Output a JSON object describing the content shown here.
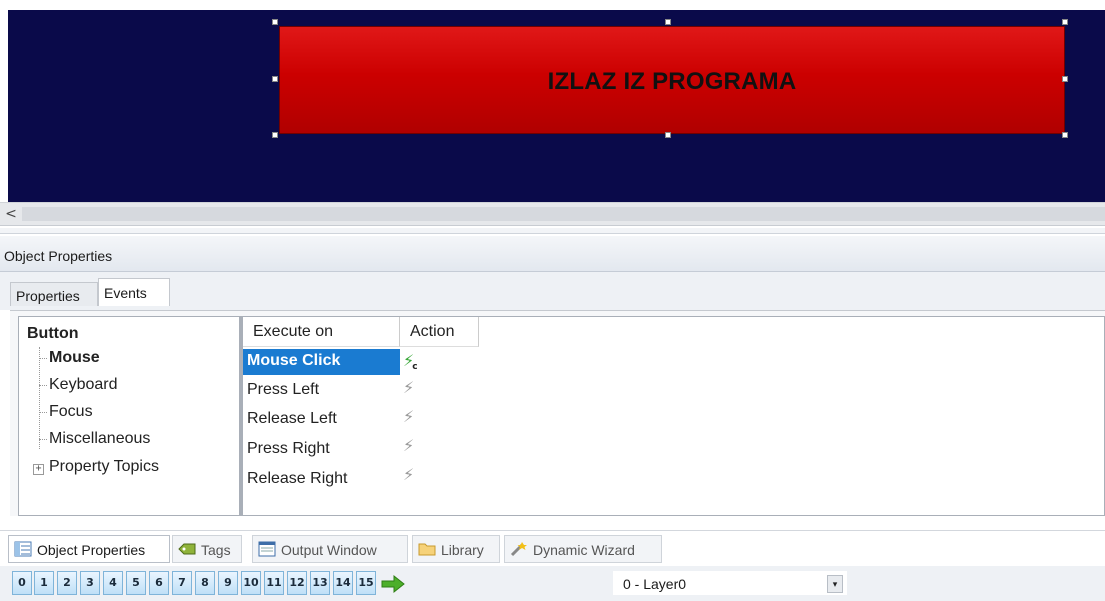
{
  "canvas": {
    "button_text": "IZLAZ IZ PROGRAMA",
    "background_color": "#0a0a4a",
    "button_color": "#cc0000"
  },
  "scrollbar": {
    "left_arrow": "<"
  },
  "panel": {
    "title": "Object Properties",
    "tabs": [
      "Properties",
      "Events"
    ],
    "active_tab": "Events"
  },
  "tree": {
    "root": "Button",
    "items": [
      "Mouse",
      "Keyboard",
      "Focus",
      "Miscellaneous",
      "Property Topics"
    ],
    "selected": "Mouse",
    "expander": "+"
  },
  "grid": {
    "headers": [
      "Execute on",
      "Action"
    ],
    "rows": [
      {
        "event": "Mouse Click",
        "action_icon": "green-lightning-icon",
        "selected": true,
        "action_subscript": "c"
      },
      {
        "event": "Press Left",
        "action_icon": "gray-lightning-icon"
      },
      {
        "event": "Release Left",
        "action_icon": "gray-lightning-icon"
      },
      {
        "event": "Press Right",
        "action_icon": "gray-lightning-icon"
      },
      {
        "event": "Release Right",
        "action_icon": "gray-lightning-icon"
      }
    ],
    "selected_color": "#1a7bd1"
  },
  "dock_tabs": [
    {
      "label": "Object Properties",
      "icon": "properties-icon"
    },
    {
      "label": "Tags",
      "icon": "tag-icon"
    },
    {
      "label": "Output Window",
      "icon": "output-window-icon"
    },
    {
      "label": "Library",
      "icon": "folder-icon"
    },
    {
      "label": "Dynamic Wizard",
      "icon": "wizard-icon"
    }
  ],
  "layers": {
    "buttons": [
      "0",
      "1",
      "2",
      "3",
      "4",
      "5",
      "6",
      "7",
      "8",
      "9",
      "10",
      "11",
      "12",
      "13",
      "14",
      "15"
    ],
    "arrow_icon": "green-arrow-icon",
    "selected_layer": "0 - Layer0",
    "dropdown_glyph": "▾"
  }
}
